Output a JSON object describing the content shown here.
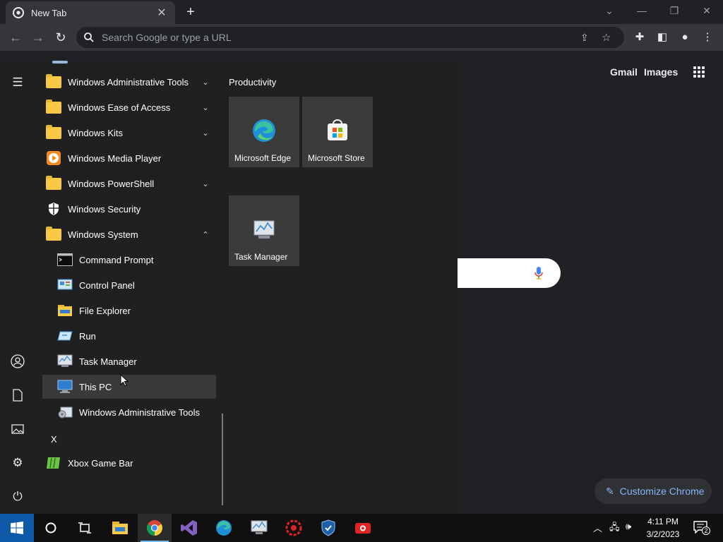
{
  "chrome": {
    "tab_title": "New Tab",
    "omnibox_placeholder": "Search Google or type a URL",
    "ntp_links": [
      "Gmail",
      "Images"
    ],
    "customize_label": "Customize Chrome"
  },
  "start_menu": {
    "items": [
      {
        "label": "Windows Administrative Tools",
        "icon": "folder-icon",
        "chevron": "⌄"
      },
      {
        "label": "Windows Ease of Access",
        "icon": "folder-icon",
        "chevron": "⌄"
      },
      {
        "label": "Windows Kits",
        "icon": "folder-icon",
        "chevron": "⌄"
      },
      {
        "label": "Windows Media Player",
        "icon": "media-player-icon",
        "chevron": ""
      },
      {
        "label": "Windows PowerShell",
        "icon": "folder-icon",
        "chevron": "⌄"
      },
      {
        "label": "Windows Security",
        "icon": "shield-icon",
        "chevron": ""
      },
      {
        "label": "Windows System",
        "icon": "folder-icon",
        "chevron": "⌃"
      },
      {
        "label": "Command Prompt",
        "icon": "command-prompt-icon",
        "chevron": ""
      },
      {
        "label": "Control Panel",
        "icon": "control-panel-icon",
        "chevron": ""
      },
      {
        "label": "File Explorer",
        "icon": "file-explorer-icon",
        "chevron": ""
      },
      {
        "label": "Run",
        "icon": "run-icon",
        "chevron": ""
      },
      {
        "label": "Task Manager",
        "icon": "task-manager-icon",
        "chevron": ""
      },
      {
        "label": "This PC",
        "icon": "this-pc-icon",
        "chevron": ""
      },
      {
        "label": "Windows Administrative Tools",
        "icon": "admin-tools-icon",
        "chevron": ""
      }
    ],
    "letter_x": "X",
    "xbox_label": "Xbox Game Bar",
    "group_title": "Productivity",
    "tiles": [
      "Microsoft Edge",
      "Microsoft Store",
      "Task Manager"
    ]
  },
  "taskbar": {
    "time": "4:11 PM",
    "date": "3/2/2023",
    "notification_count": "2"
  }
}
